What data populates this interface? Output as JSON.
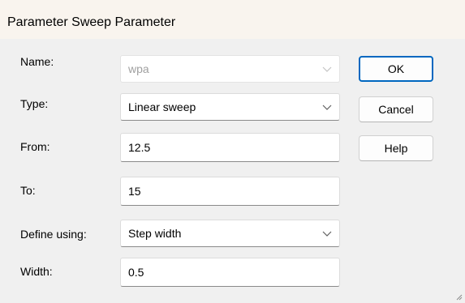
{
  "dialog": {
    "title": "Parameter Sweep Parameter"
  },
  "form": {
    "name": {
      "label": "Name:",
      "value": "wpa",
      "disabled": true
    },
    "type": {
      "label": "Type:",
      "value": "Linear sweep"
    },
    "from": {
      "label": "From:",
      "value": "12.5"
    },
    "to": {
      "label": "To:",
      "value": "15"
    },
    "define_using": {
      "label": "Define using:",
      "value": "Step width"
    },
    "width": {
      "label": "Width:",
      "value": "0.5"
    }
  },
  "buttons": {
    "ok": "OK",
    "cancel": "Cancel",
    "help": "Help"
  },
  "icons": {
    "dropdown": "chevron-down-icon",
    "resize": "resize-grip-icon"
  },
  "colors": {
    "accent": "#0067c0",
    "titlebar_bg": "#f9f4ee",
    "dialog_bg": "#f0f0f0"
  }
}
